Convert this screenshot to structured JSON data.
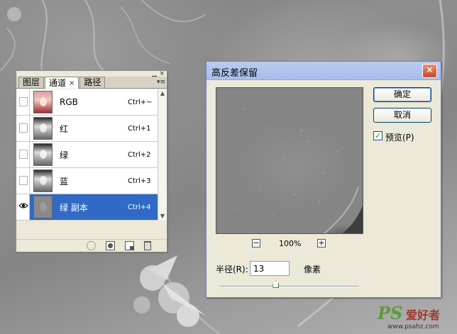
{
  "channels_panel": {
    "tabs": [
      {
        "label": "图层",
        "active": false
      },
      {
        "label": "通道",
        "active": true
      },
      {
        "label": "路径",
        "active": false
      }
    ],
    "tab_close_glyph": "×",
    "minimize_glyph": "▁",
    "close_glyph": "×",
    "menu_glyph": "▾≡",
    "channels": [
      {
        "name": "RGB",
        "shortcut": "Ctrl+~",
        "visible": false,
        "selected": false,
        "thumb": "color"
      },
      {
        "name": "红",
        "shortcut": "Ctrl+1",
        "visible": false,
        "selected": false,
        "thumb": "gray"
      },
      {
        "name": "绿",
        "shortcut": "Ctrl+2",
        "visible": false,
        "selected": false,
        "thumb": "gray"
      },
      {
        "name": "蓝",
        "shortcut": "Ctrl+3",
        "visible": false,
        "selected": false,
        "thumb": "gray"
      },
      {
        "name": "绿 副本",
        "shortcut": "Ctrl+4",
        "visible": true,
        "selected": true,
        "thumb": "hp"
      }
    ],
    "bottom_icons": [
      "load-selection-icon",
      "save-mask-icon",
      "new-channel-icon",
      "trash-icon"
    ]
  },
  "dialog": {
    "title": "高反差保留",
    "close_glyph": "✕",
    "ok_label": "确定",
    "cancel_label": "取消",
    "preview_label": "预览(P)",
    "preview_checked": true,
    "zoom_out_glyph": "−",
    "zoom_in_glyph": "+",
    "zoom_value": "100%",
    "radius_label": "半径(R):",
    "radius_value": "13",
    "radius_unit": "像素",
    "radius_slider_fraction": 0.4
  },
  "watermark": {
    "ps": "PS",
    "cn": "爱好者",
    "url": "www.psahz.com"
  },
  "colors": {
    "selection": "#316ac5",
    "titlebar": "#a8bdea",
    "close_button": "#c64a2a",
    "check": "#21a121"
  }
}
